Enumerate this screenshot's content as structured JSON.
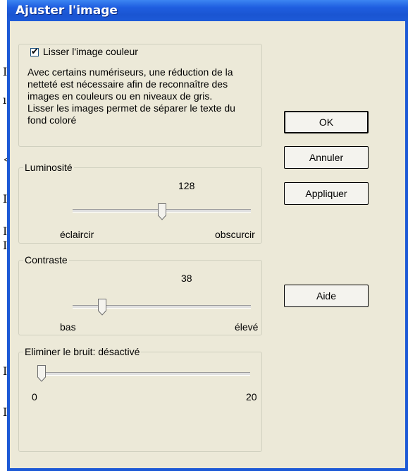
{
  "window": {
    "title": "Ajuster l'image"
  },
  "smoothing": {
    "checkbox_label": "Lisser l'image couleur",
    "checked": true,
    "description_lines": [
      "Avec certains numériseurs, une réduction de la",
      "netteté est nécessaire afin de reconnaître des",
      "images en couleurs ou en niveaux de gris.",
      "Lisser les images permet de séparer le texte du",
      "fond coloré"
    ]
  },
  "brightness": {
    "label": "Luminosité",
    "value": "128",
    "min_label": "éclaircir",
    "max_label": "obscurcir",
    "position": 0.5
  },
  "contrast": {
    "label": "Contraste",
    "value": "38",
    "min_label": "bas",
    "max_label": "élevé",
    "position": 0.15
  },
  "noise": {
    "label": "Eliminer le bruit: désactivé",
    "min_label": "0",
    "max_label": "20",
    "position": 0
  },
  "buttons": {
    "ok": "OK",
    "cancel": "Annuler",
    "apply": "Appliquer",
    "help": "Aide"
  },
  "colors": {
    "titlebar": "#1f5ee0",
    "dialog_bg": "#ece9d8"
  }
}
